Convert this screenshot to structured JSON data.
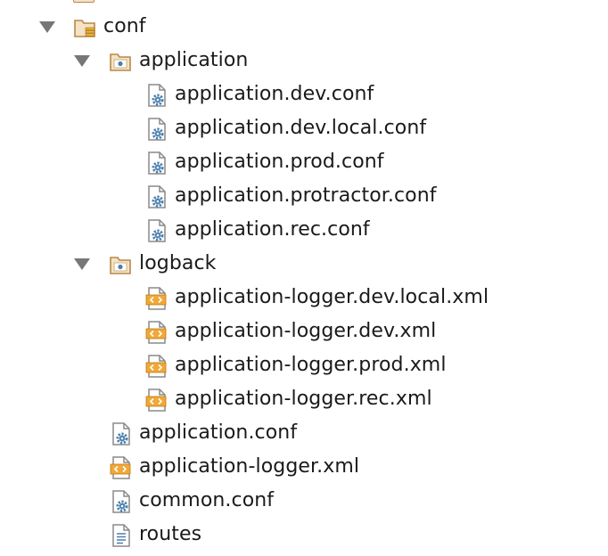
{
  "tree": {
    "conf": {
      "label": "conf",
      "icon": "resource-folder-icon",
      "expanded": true,
      "children": {
        "application_folder": {
          "label": "application",
          "icon": "source-folder-icon",
          "expanded": true,
          "files": [
            {
              "label": "application.dev.conf",
              "icon": "config-file-icon"
            },
            {
              "label": "application.dev.local.conf",
              "icon": "config-file-icon"
            },
            {
              "label": "application.prod.conf",
              "icon": "config-file-icon"
            },
            {
              "label": "application.protractor.conf",
              "icon": "config-file-icon"
            },
            {
              "label": "application.rec.conf",
              "icon": "config-file-icon"
            }
          ]
        },
        "logback_folder": {
          "label": "logback",
          "icon": "source-folder-icon",
          "expanded": true,
          "files": [
            {
              "label": "application-logger.dev.local.xml",
              "icon": "xml-file-icon"
            },
            {
              "label": "application-logger.dev.xml",
              "icon": "xml-file-icon"
            },
            {
              "label": "application-logger.prod.xml",
              "icon": "xml-file-icon"
            },
            {
              "label": "application-logger.rec.xml",
              "icon": "xml-file-icon"
            }
          ]
        },
        "files": [
          {
            "label": "application.conf",
            "icon": "config-file-icon"
          },
          {
            "label": "application-logger.xml",
            "icon": "xml-file-icon"
          },
          {
            "label": "common.conf",
            "icon": "config-file-icon"
          },
          {
            "label": "routes",
            "icon": "text-file-icon"
          }
        ]
      }
    }
  },
  "colors": {
    "arrow": "#777777",
    "folder_fill": "#f4e3c5",
    "folder_stroke": "#b8884a",
    "gear": "#4a7fae",
    "xml_badge": "#f0a838",
    "file_stroke": "#8a8a8a",
    "text": "#1a1a1a"
  }
}
